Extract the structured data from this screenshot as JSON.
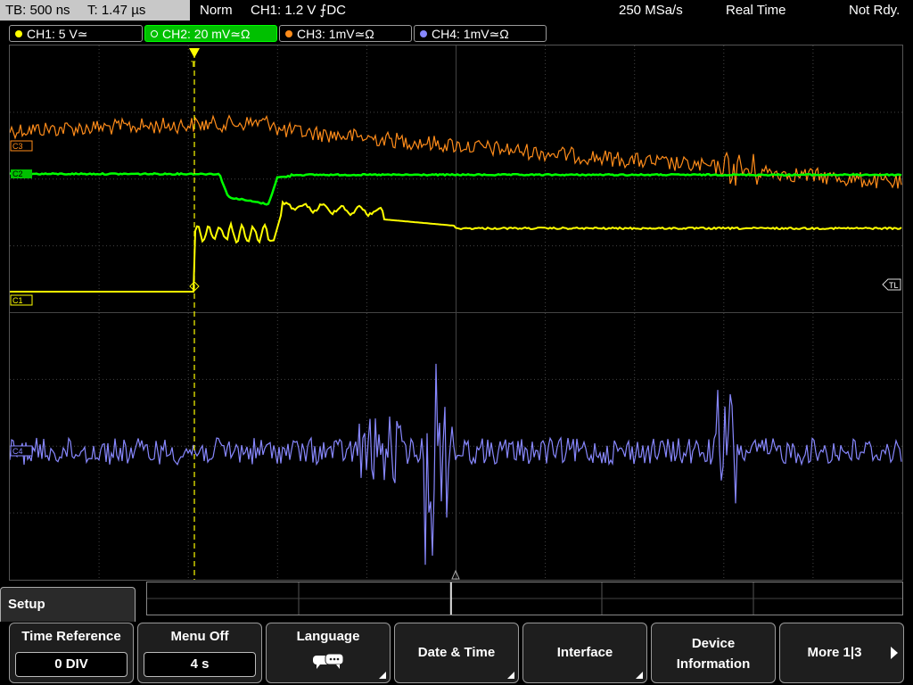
{
  "topbar": {
    "timebase": "TB: 500 ns",
    "trigger_time": "T: 1.47 µs",
    "trigger_mode": "Norm",
    "trigger_source": "CH1: 1.2 V ⨍DC",
    "sample_rate": "250 MSa/s",
    "acq_mode": "Real Time",
    "status": "Not Rdy."
  },
  "channels": [
    {
      "label": "CH1: 5 V≃",
      "color": "#ffff00",
      "active": false
    },
    {
      "label": "CH2: 20 mV≃Ω",
      "color": "#00ff00",
      "active": true
    },
    {
      "label": "CH3: 1mV≃Ω",
      "color": "#ff8c1a",
      "active": false
    },
    {
      "label": "CH4: 1mV≃Ω",
      "color": "#8888ff",
      "active": false
    }
  ],
  "markers": {
    "c3": "C3",
    "c2": "C2",
    "c1": "C1",
    "c4": "C4",
    "tl": "TL",
    "trigger": "T"
  },
  "menu": {
    "tab": "Setup",
    "buttons": {
      "time_reference": {
        "label": "Time Reference",
        "value": "0 DIV"
      },
      "menu_off": {
        "label": "Menu Off",
        "value": "4 s"
      },
      "language": {
        "label": "Language"
      },
      "date_time": {
        "label": "Date & Time"
      },
      "interface": {
        "label": "Interface"
      },
      "device_info": {
        "label": "Device\nInformation",
        "line1": "Device",
        "line2": "Information"
      },
      "more": {
        "label": "More 1|3"
      }
    }
  },
  "colors": {
    "ch1": "#ffff00",
    "ch2": "#00ff00",
    "ch3": "#ff8c1a",
    "ch4": "#8888ff",
    "grid": "#555555"
  }
}
